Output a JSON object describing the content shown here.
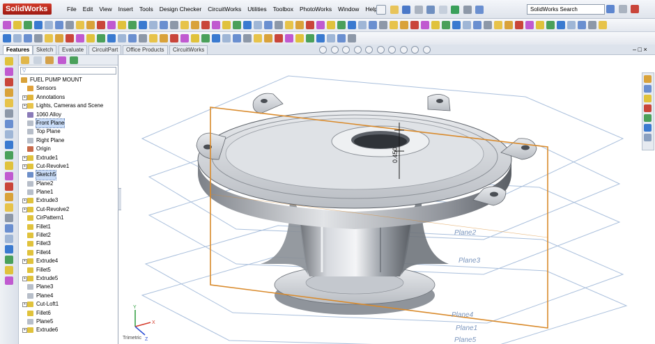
{
  "app": {
    "logo": "SolidWorks"
  },
  "menu": [
    "File",
    "Edit",
    "View",
    "Insert",
    "Tools",
    "Design Checker",
    "CircuitWorks",
    "Utilities",
    "Toolbox",
    "PhotoWorks",
    "Window",
    "Help"
  ],
  "search": {
    "placeholder": "SolidWorks Search"
  },
  "cm_tabs": [
    "Features",
    "Sketch",
    "Evaluate",
    "CircuitPart",
    "Office Products",
    "CircuitWorks"
  ],
  "tree": {
    "filter_icon": "funnel-icon",
    "items": [
      {
        "label": "FUEL PUMP MOUNT",
        "icon": "part-icon",
        "level": 0,
        "expand": false,
        "color": "#d9a23a"
      },
      {
        "label": "Sensors",
        "icon": "sensor-icon",
        "level": 1,
        "expand": false,
        "color": "#e0a13a"
      },
      {
        "label": "Annotations",
        "icon": "annotation-icon",
        "level": 1,
        "expand": true,
        "color": "#e0b43a"
      },
      {
        "label": "Lights, Cameras and Scene",
        "icon": "lights-icon",
        "level": 1,
        "expand": true,
        "color": "#e7c34a"
      },
      {
        "label": "1060 Alloy",
        "icon": "material-icon",
        "level": 1,
        "expand": false,
        "color": "#8a7bb8"
      },
      {
        "label": "Front Plane",
        "icon": "plane-icon",
        "level": 1,
        "expand": false,
        "color": "#b7bec9",
        "selected": true
      },
      {
        "label": "Top Plane",
        "icon": "plane-icon",
        "level": 1,
        "expand": false,
        "color": "#b7bec9"
      },
      {
        "label": "Right Plane",
        "icon": "plane-icon",
        "level": 1,
        "expand": false,
        "color": "#b7bec9"
      },
      {
        "label": "Origin",
        "icon": "origin-icon",
        "level": 1,
        "expand": false,
        "color": "#c86a4a"
      },
      {
        "label": "Extrude1",
        "icon": "extrude-icon",
        "level": 1,
        "expand": true,
        "color": "#e0c23c"
      },
      {
        "label": "Cut-Revolve1",
        "icon": "cut-revolve-icon",
        "level": 1,
        "expand": true,
        "color": "#e0c23c"
      },
      {
        "label": "Sketch5",
        "icon": "sketch-icon",
        "level": 1,
        "expand": false,
        "color": "#6d8fc9",
        "selected": true
      },
      {
        "label": "Plane2",
        "icon": "plane-icon",
        "level": 1,
        "expand": false,
        "color": "#b7bec9"
      },
      {
        "label": "Plane1",
        "icon": "plane-icon",
        "level": 1,
        "expand": false,
        "color": "#b7bec9"
      },
      {
        "label": "Extrude3",
        "icon": "extrude-icon",
        "level": 1,
        "expand": true,
        "color": "#e0c23c"
      },
      {
        "label": "Cut-Revolve2",
        "icon": "cut-revolve-icon",
        "level": 1,
        "expand": true,
        "color": "#e0c23c"
      },
      {
        "label": "CirPattern1",
        "icon": "pattern-icon",
        "level": 1,
        "expand": false,
        "color": "#e0c23c"
      },
      {
        "label": "Fillet1",
        "icon": "fillet-icon",
        "level": 1,
        "expand": false,
        "color": "#e0c23c"
      },
      {
        "label": "Fillet2",
        "icon": "fillet-icon",
        "level": 1,
        "expand": false,
        "color": "#e0c23c"
      },
      {
        "label": "Fillet3",
        "icon": "fillet-icon",
        "level": 1,
        "expand": false,
        "color": "#e0c23c"
      },
      {
        "label": "Fillet4",
        "icon": "fillet-icon",
        "level": 1,
        "expand": false,
        "color": "#e0c23c"
      },
      {
        "label": "Extrude4",
        "icon": "extrude-icon",
        "level": 1,
        "expand": true,
        "color": "#e0c23c"
      },
      {
        "label": "Fillet5",
        "icon": "fillet-icon",
        "level": 1,
        "expand": false,
        "color": "#e0c23c"
      },
      {
        "label": "Extrude5",
        "icon": "extrude-icon",
        "level": 1,
        "expand": true,
        "color": "#e0c23c"
      },
      {
        "label": "Plane3",
        "icon": "plane-icon",
        "level": 1,
        "expand": false,
        "color": "#b7bec9"
      },
      {
        "label": "Plane4",
        "icon": "plane-icon",
        "level": 1,
        "expand": false,
        "color": "#b7bec9"
      },
      {
        "label": "Cut-Loft1",
        "icon": "cut-loft-icon",
        "level": 1,
        "expand": true,
        "color": "#e0c23c"
      },
      {
        "label": "Fillet6",
        "icon": "fillet-icon",
        "level": 1,
        "expand": false,
        "color": "#e0c23c"
      },
      {
        "label": "Plane5",
        "icon": "plane-icon",
        "level": 1,
        "expand": false,
        "color": "#b7bec9"
      },
      {
        "label": "Extrude6",
        "icon": "extrude-icon",
        "level": 1,
        "expand": true,
        "color": "#e0c23c"
      }
    ]
  },
  "viewport": {
    "plane_labels": [
      "Plane2",
      "Plane3",
      "Plane4",
      "Plane1",
      "Plane5"
    ],
    "dimension": "0.450",
    "triad": [
      "X",
      "Y",
      "Z"
    ],
    "status": "Trimetric"
  },
  "colors": {
    "accent": "#3562a8",
    "sketch_plane": "#d98a2b",
    "ref_plane": "#9fb6d6",
    "triad_x": "#d43a2a",
    "triad_y": "#2a9a3a",
    "triad_z": "#2a4ed4"
  }
}
